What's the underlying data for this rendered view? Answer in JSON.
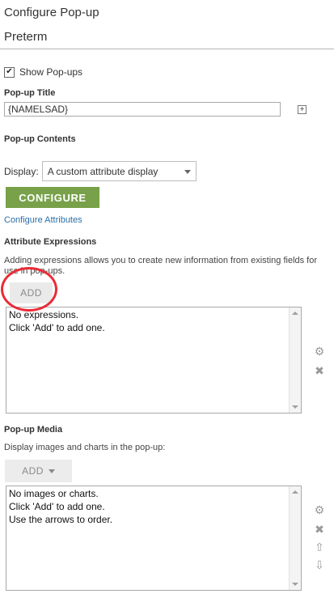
{
  "panel": {
    "title": "Configure Pop-up",
    "layer_name": "Preterm"
  },
  "show_popups": {
    "checked": true,
    "label": "Show Pop-ups"
  },
  "popup_title": {
    "label": "Pop-up Title",
    "value": "{NAMELSAD}"
  },
  "popup_contents": {
    "label": "Pop-up Contents",
    "display_label": "Display:",
    "display_value": "A custom attribute display",
    "configure_button": "CONFIGURE",
    "configure_attributes_link": "Configure Attributes"
  },
  "attribute_expressions": {
    "label": "Attribute Expressions",
    "description": "Adding expressions allows you to create new information from existing fields for use in pop-ups.",
    "add_button": "ADD",
    "list_lines": [
      "No expressions.",
      "Click 'Add' to add one."
    ]
  },
  "popup_media": {
    "label": "Pop-up Media",
    "description": "Display images and charts in the pop-up:",
    "add_button": "ADD",
    "list_lines": [
      "No images or charts.",
      "Click 'Add' to add one.",
      "Use the arrows to order."
    ]
  },
  "icons": [
    "gear-icon",
    "delete-icon",
    "move-up-icon",
    "move-down-icon",
    "plus-icon",
    "checkbox-check-icon"
  ],
  "colors": {
    "configure_button": "#78a14a",
    "link": "#2a6ea6",
    "highlight_circle": "#ea2b35"
  }
}
